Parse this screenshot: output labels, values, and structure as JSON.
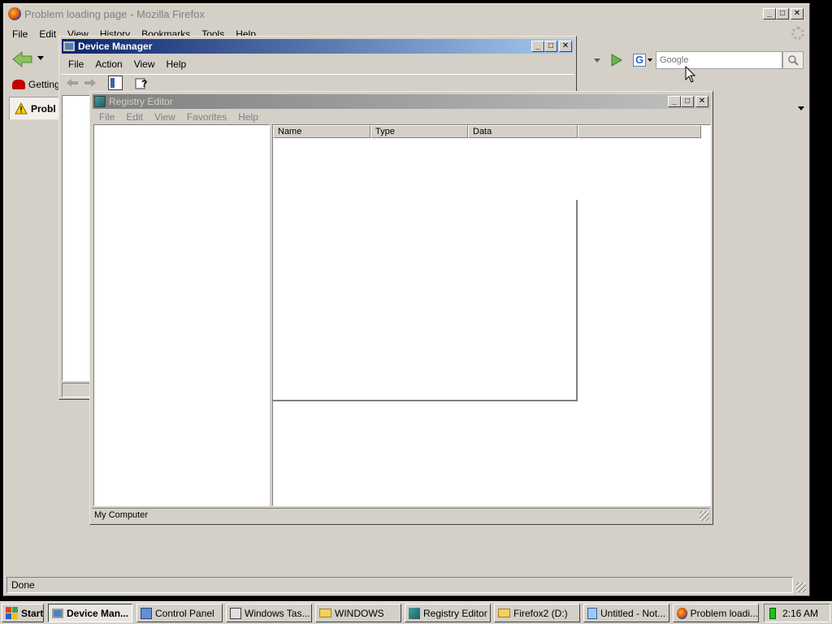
{
  "firefox": {
    "title": "Problem loading page - Mozilla Firefox",
    "menu": [
      "File",
      "Edit",
      "View",
      "History",
      "Bookmarks",
      "Tools",
      "Help"
    ],
    "search_placeholder": "Google",
    "bookmark_label": "Getting",
    "tab_label": "Probl",
    "status": "Done"
  },
  "device_manager": {
    "title": "Device Manager",
    "menu": [
      "File",
      "Action",
      "View",
      "Help"
    ]
  },
  "registry_editor": {
    "title": "Registry Editor",
    "menu": [
      "File",
      "Edit",
      "View",
      "Favorites",
      "Help"
    ],
    "columns": [
      "Name",
      "Type",
      "Data"
    ],
    "status": "My Computer"
  },
  "taskbar": {
    "start_label": "Start",
    "items": [
      {
        "label": "Device Man...",
        "icon": "computer-icon",
        "active": true
      },
      {
        "label": "Control Panel",
        "icon": "control-panel-icon",
        "active": false
      },
      {
        "label": "Windows Tas...",
        "icon": "task-manager-icon",
        "active": false
      },
      {
        "label": "WINDOWS",
        "icon": "folder-icon",
        "active": false
      },
      {
        "label": "Registry Editor",
        "icon": "registry-icon",
        "active": false
      },
      {
        "label": "Firefox2 (D:)",
        "icon": "folder-icon",
        "active": false
      },
      {
        "label": "Untitled - Not...",
        "icon": "notepad-icon",
        "active": false
      },
      {
        "label": "Problem loadi...",
        "icon": "firefox-icon",
        "active": false
      }
    ],
    "clock": "2:16 AM"
  }
}
